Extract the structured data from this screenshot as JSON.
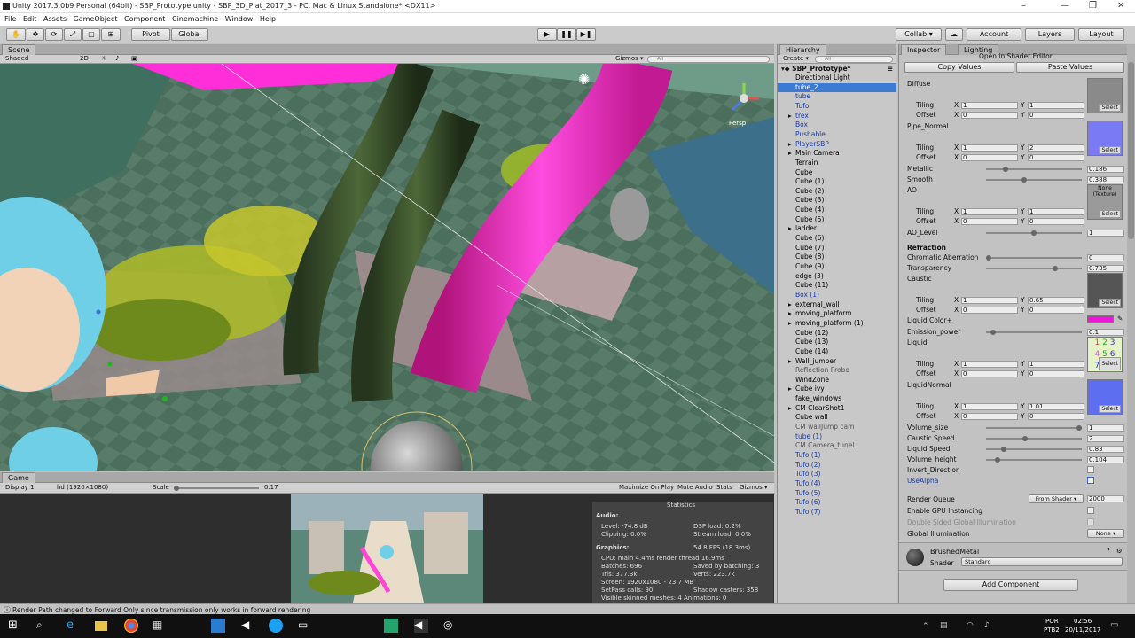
{
  "window": {
    "title": "Unity 2017.3.0b9 Personal (64bit) - SBP_Prototype.unity - SBP_3D_Plat_2017_3 - PC, Mac & Linux Standalone* <DX11>"
  },
  "menu": [
    "File",
    "Edit",
    "Assets",
    "GameObject",
    "Component",
    "Cinemachine",
    "Window",
    "Help"
  ],
  "toolbar": {
    "pivot": "Pivot",
    "global": "Global",
    "collab": "Collab ▾",
    "account": "Account",
    "layers": "Layers",
    "layout": "Layout"
  },
  "scene": {
    "tab": "Scene",
    "shading": "Shaded",
    "mode2d": "2D",
    "gizmos": "Gizmos ▾",
    "search_placeholder": "All",
    "persp": "Persp"
  },
  "game": {
    "tab": "Game",
    "display": "Display 1",
    "resolution": "hd (1920×1080)",
    "scale_label": "Scale",
    "scale_value": "0.17",
    "maximize": "Maximize On Play",
    "mute": "Mute Audio",
    "stats": "Stats",
    "gizmos": "Gizmos ▾",
    "stats_panel": {
      "title": "Statistics",
      "audio": "Audio:",
      "level": "Level: -74.8 dB",
      "clipping": "Clipping: 0.0%",
      "dsp": "DSP load: 0.2%",
      "stream": "Stream load: 0.0%",
      "graphics": "Graphics:",
      "fps": "54.8 FPS (18.3ms)",
      "cpu": "CPU: main 4.4ms  render thread 16.9ms",
      "batches": "Batches: 696",
      "saved": "Saved by batching: 3",
      "tris": "Tris: 377.3k",
      "verts": "Verts: 223.7k",
      "screen": "Screen: 1920x1080 - 23.7 MB",
      "setpass": "SetPass calls: 90",
      "shadow": "Shadow casters: 358",
      "skinned": "Visible skinned meshes: 4  Animations: 0"
    }
  },
  "hierarchy": {
    "tab": "Hierarchy",
    "create": "Create ▾",
    "search_placeholder": "All",
    "scene_name": "SBP_Prototype*",
    "items": [
      {
        "label": "Directional Light",
        "color": "#000000",
        "arrow": ""
      },
      {
        "label": "tube_2",
        "color": "#ffffff",
        "arrow": "",
        "selected": true
      },
      {
        "label": "tube",
        "color": "#1a3da8",
        "arrow": ""
      },
      {
        "label": "Tufo",
        "color": "#1a3da8",
        "arrow": ""
      },
      {
        "label": "trex",
        "color": "#1a3da8",
        "arrow": "▸"
      },
      {
        "label": "Box",
        "color": "#1a3da8",
        "arrow": ""
      },
      {
        "label": "Pushable",
        "color": "#1a3da8",
        "arrow": ""
      },
      {
        "label": "PlayerSBP",
        "color": "#1a3da8",
        "arrow": "▸"
      },
      {
        "label": "Main Camera",
        "color": "#000000",
        "arrow": "▸"
      },
      {
        "label": "Terrain",
        "color": "#000000",
        "arrow": ""
      },
      {
        "label": "Cube",
        "color": "#000000",
        "arrow": ""
      },
      {
        "label": "Cube (1)",
        "color": "#000000",
        "arrow": ""
      },
      {
        "label": "Cube (2)",
        "color": "#000000",
        "arrow": ""
      },
      {
        "label": "Cube (3)",
        "color": "#000000",
        "arrow": ""
      },
      {
        "label": "Cube (4)",
        "color": "#000000",
        "arrow": ""
      },
      {
        "label": "Cube (5)",
        "color": "#000000",
        "arrow": ""
      },
      {
        "label": "ladder",
        "color": "#000000",
        "arrow": "▸"
      },
      {
        "label": "Cube (6)",
        "color": "#000000",
        "arrow": ""
      },
      {
        "label": "Cube (7)",
        "color": "#000000",
        "arrow": ""
      },
      {
        "label": "Cube (8)",
        "color": "#000000",
        "arrow": ""
      },
      {
        "label": "Cube (9)",
        "color": "#000000",
        "arrow": ""
      },
      {
        "label": "edge (3)",
        "color": "#000000",
        "arrow": ""
      },
      {
        "label": "Cube (11)",
        "color": "#000000",
        "arrow": ""
      },
      {
        "label": "Box (1)",
        "color": "#1a3da8",
        "arrow": ""
      },
      {
        "label": "external_wall",
        "color": "#000000",
        "arrow": "▸"
      },
      {
        "label": "moving_platform",
        "color": "#000000",
        "arrow": "▸"
      },
      {
        "label": "moving_platform (1)",
        "color": "#000000",
        "arrow": "▸"
      },
      {
        "label": "Cube (12)",
        "color": "#000000",
        "arrow": ""
      },
      {
        "label": "Cube (13)",
        "color": "#000000",
        "arrow": ""
      },
      {
        "label": "Cube (14)",
        "color": "#000000",
        "arrow": ""
      },
      {
        "label": "Wall_jumper",
        "color": "#000000",
        "arrow": "▸"
      },
      {
        "label": "Reflection Probe",
        "color": "#555555",
        "arrow": ""
      },
      {
        "label": "WindZone",
        "color": "#000000",
        "arrow": ""
      },
      {
        "label": "Cube ivy",
        "color": "#000000",
        "arrow": "▸"
      },
      {
        "label": "fake_windows",
        "color": "#000000",
        "arrow": ""
      },
      {
        "label": "CM ClearShot1",
        "color": "#000000",
        "arrow": "▸"
      },
      {
        "label": "Cube wall",
        "color": "#000000",
        "arrow": ""
      },
      {
        "label": "CM wallJump cam",
        "color": "#555555",
        "arrow": ""
      },
      {
        "label": "tube (1)",
        "color": "#1a3da8",
        "arrow": ""
      },
      {
        "label": "CM Camera_tunel",
        "color": "#555555",
        "arrow": ""
      },
      {
        "label": "Tufo (1)",
        "color": "#1a3da8",
        "arrow": ""
      },
      {
        "label": "Tufo (2)",
        "color": "#1a3da8",
        "arrow": ""
      },
      {
        "label": "Tufo (3)",
        "color": "#1a3da8",
        "arrow": ""
      },
      {
        "label": "Tufo (4)",
        "color": "#1a3da8",
        "arrow": ""
      },
      {
        "label": "Tufo (5)",
        "color": "#1a3da8",
        "arrow": ""
      },
      {
        "label": "Tufo (6)",
        "color": "#1a3da8",
        "arrow": ""
      },
      {
        "label": "Tufo (7)",
        "color": "#1a3da8",
        "arrow": ""
      }
    ]
  },
  "inspector": {
    "tab": "Inspector",
    "lighting_tab": "Lighting",
    "open_shader": "Open in Shader Editor",
    "copy": "Copy Values",
    "paste": "Paste Values",
    "select": "Select",
    "diffuse": "Diffuse",
    "tiling": "Tiling",
    "offset": "Offset",
    "x": "X",
    "y": "Y",
    "t1": {
      "tx": "1",
      "ty": "1",
      "ox": "0",
      "oy": "0"
    },
    "pipe_normal": "Pipe_Normal",
    "t2": {
      "tx": "1",
      "ty": "2",
      "ox": "0",
      "oy": "0"
    },
    "metallic": "Metallic",
    "metallic_v": "0.186",
    "metallic_f": 0.186,
    "smooth": "Smooth",
    "smooth_v": "0.388",
    "smooth_f": 0.388,
    "ao": "AO",
    "none_tex": "None (Texture)",
    "t3": {
      "tx": "1",
      "ty": "1",
      "ox": "0",
      "oy": "0"
    },
    "ao_level": "AO_Level",
    "ao_level_v": "1",
    "ao_level_f": 0.5,
    "refraction": "Refraction",
    "chromatic": "Chromatic Aberration",
    "chromatic_v": "0",
    "chromatic_f": 0,
    "transparency": "Transparency",
    "transparency_v": "0.735",
    "transparency_f": 0.735,
    "caustic": "Caustic",
    "t4": {
      "tx": "1",
      "ty": "0.65",
      "ox": "0",
      "oy": "0"
    },
    "liquid_color": "Liquid Color+",
    "liquid_color_hex": "#e81ad6",
    "emission": "Emission_power",
    "emission_v": "0.1",
    "emission_f": 0.05,
    "liquid": "Liquid",
    "t5": {
      "tx": "1",
      "ty": "1",
      "ox": "0",
      "oy": "0"
    },
    "liquid_normal": "LiquidNormal",
    "t6": {
      "tx": "1",
      "ty": "1.01",
      "ox": "0",
      "oy": "0"
    },
    "volume_size": "Volume_size",
    "volume_size_v": "1",
    "volume_size_f": 1,
    "caustic_speed": "Caustic Speed",
    "caustic_speed_v": "2",
    "caustic_speed_f": 0.4,
    "liquid_speed": "Liquid Speed",
    "liquid_speed_v": "0.83",
    "liquid_speed_f": 0.17,
    "volume_height": "Volume_height",
    "volume_height_v": "0.104",
    "volume_height_f": 0.1,
    "invert": "Invert_Direction",
    "usealpha": "UseAlpha",
    "render_queue": "Render Queue",
    "from_shader": "From Shader ▾",
    "render_queue_v": "2000",
    "gpu": "Enable GPU Instancing",
    "double_sided": "Double Sided Global Illumination",
    "global_illum": "Global Illumination",
    "global_illum_v": "None ▾",
    "material_name": "BrushedMetal",
    "shader_label": "Shader",
    "shader_value": "Standard",
    "add_component": "Add Component",
    "liquid_digits": [
      "1",
      "2",
      "3",
      "4",
      "5",
      "6",
      "7",
      "8",
      "9"
    ]
  },
  "status": "Render Path changed to Forward Only since transmission only works in forward rendering",
  "taskbar": {
    "lang": "POR",
    "kb": "PTB2",
    "time": "02:56",
    "date": "20/11/2017"
  }
}
